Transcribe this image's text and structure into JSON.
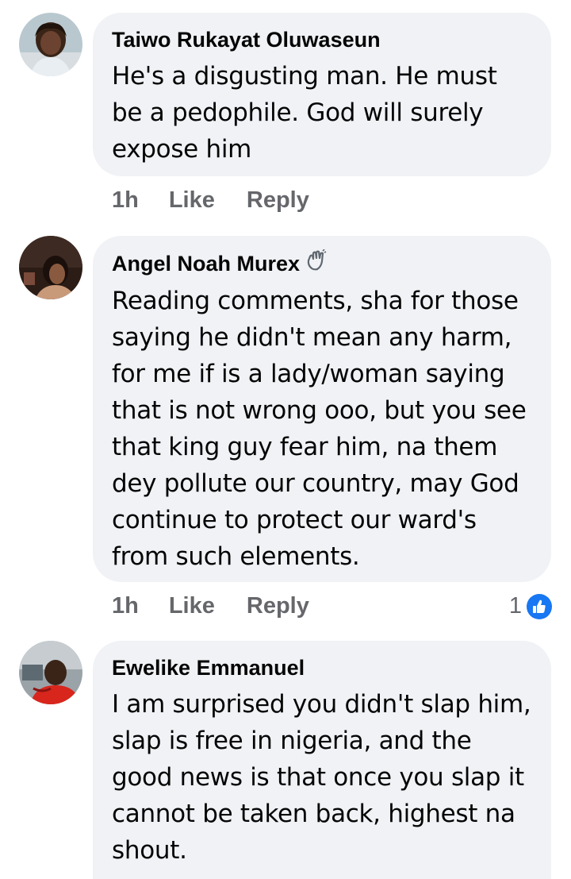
{
  "comments": [
    {
      "author": "Taiwo Rukayat Oluwaseun",
      "text": "He's a disgusting man. He must be a pedophile. God will surely expose him",
      "time": "1h",
      "like_label": "Like",
      "reply_label": "Reply"
    },
    {
      "author": "Angel Noah Murex",
      "text": "Reading comments, sha for those saying he didn't mean any harm, for me if is a lady/woman saying that is not wrong ooo, but you see that king guy fear him, na them dey  pollute our country, may God continue to protect our ward's from such elements.",
      "time": "1h",
      "like_label": "Like",
      "reply_label": "Reply",
      "reaction_count": "1",
      "badge_icon": "waving-hand-icon",
      "reaction_icon": "thumbs-up-icon"
    },
    {
      "author": "Ewelike Emmanuel",
      "text": "I am surprised you didn't slap him, slap is free in nigeria, and the good news is that once you slap it cannot be taken back, highest na shout."
    }
  ],
  "colors": {
    "bubble": "#f0f2f5",
    "text": "#050505",
    "secondary": "#65676b",
    "like_blue": "#1877f2"
  }
}
